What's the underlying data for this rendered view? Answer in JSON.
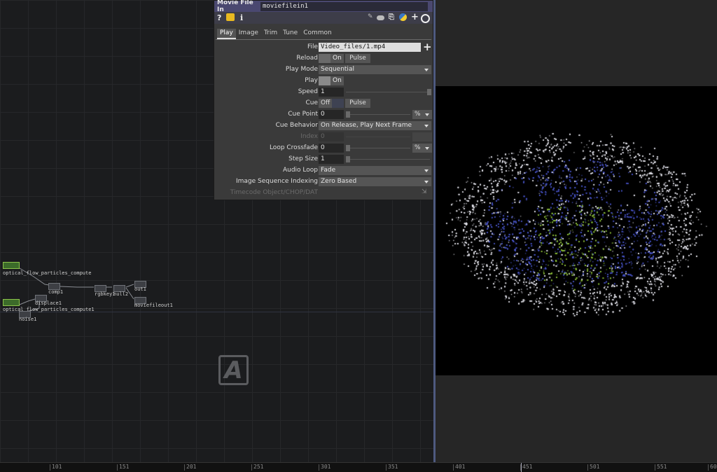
{
  "panel": {
    "type_label": "Movie File In",
    "node_name": "moviefilein1",
    "toolbar": {
      "help_icon": "?",
      "info_icon": "i"
    },
    "tabs": [
      "Play",
      "Image",
      "Trim",
      "Tune",
      "Common"
    ],
    "active_tab": "Play",
    "params": {
      "file": {
        "label": "File",
        "value": "Video_files/1.mp4"
      },
      "reload": {
        "label": "Reload",
        "toggle": "On",
        "pulse": "Pulse"
      },
      "play_mode": {
        "label": "Play Mode",
        "value": "Sequential"
      },
      "play": {
        "label": "Play",
        "toggle": "On"
      },
      "speed": {
        "label": "Speed",
        "value": "1"
      },
      "cue": {
        "label": "Cue",
        "toggle": "Off",
        "pulse": "Pulse"
      },
      "cue_point": {
        "label": "Cue Point",
        "value": "0",
        "unit": "%"
      },
      "cue_behavior": {
        "label": "Cue Behavior",
        "value": "On Release, Play Next Frame"
      },
      "index": {
        "label": "Index",
        "value": "0"
      },
      "loop_crossfade": {
        "label": "Loop Crossfade",
        "value": "0",
        "unit": "%"
      },
      "step_size": {
        "label": "Step Size",
        "value": "1"
      },
      "audio_loop": {
        "label": "Audio Loop",
        "value": "Fade"
      },
      "image_sequence_indexing": {
        "label": "Image Sequence Indexing",
        "value": "Zero Based"
      },
      "timecode_object": {
        "label": "Timecode Object/CHOP/DAT"
      }
    }
  },
  "network": {
    "nodes": {
      "optical_flow_particles_compute": "optical_flow_particles_compute",
      "optical_flow_particles_compute1": "optical_flow_particles_compute1",
      "comp1": "comp1",
      "displace1": "displace1",
      "noise1": "noise1",
      "rgbkey1": "rgbkey1",
      "null2": "null2",
      "out1": "out1",
      "moviefileout1": "moviefileout1"
    },
    "logo_letter": "A"
  },
  "timeline": {
    "ticks": [
      "101",
      "151",
      "201",
      "251",
      "301",
      "351",
      "401",
      "451",
      "501",
      "551",
      "601"
    ]
  },
  "colors": {
    "panel_header": "#4a4870",
    "particles_blue": "#4a56c8",
    "particles_green": "#8fc23c",
    "particles_white": "#e6e6ee"
  }
}
